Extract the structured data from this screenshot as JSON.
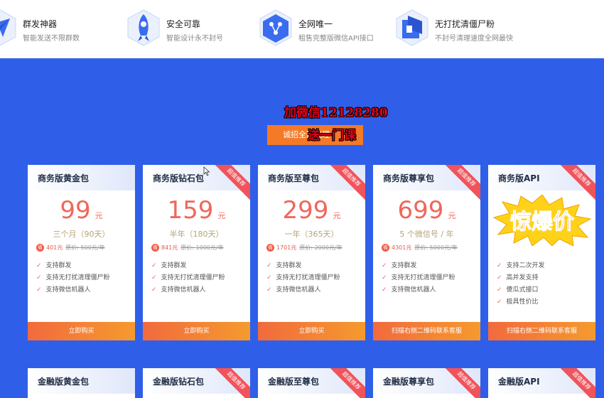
{
  "features": [
    {
      "title": "群发神器",
      "desc": "智能发送不限群数",
      "icon": "paper-plane-icon"
    },
    {
      "title": "安全可靠",
      "desc": "智能设计永不封号",
      "icon": "rocket-icon"
    },
    {
      "title": "全网唯一",
      "desc": "租售完整版微信API接口",
      "icon": "network-icon"
    },
    {
      "title": "无打扰清僵尸粉",
      "desc": "不封号清理速度全网最快",
      "icon": "shield-sweep-icon"
    }
  ],
  "promo": {
    "line1": "加微信12128280",
    "line2": "送一门课",
    "join_label": "诚招全国代理"
  },
  "ribbon_text": "超值推荐",
  "cards_row1": [
    {
      "title": "商务版黄金包",
      "price": "99",
      "unit": "元",
      "period": "三个月（90天）",
      "badge": "省",
      "save": "401元",
      "orig": "原价: 500元/年",
      "features": [
        "支持群发",
        "支持无打扰清理僵尸粉",
        "支持微信机器人"
      ],
      "button": "立即购买",
      "ribbon": false
    },
    {
      "title": "商务版钻石包",
      "price": "159",
      "unit": "元",
      "period": "半年（180天）",
      "badge": "省",
      "save": "841元",
      "orig": "原价: 1000元/年",
      "features": [
        "支持群发",
        "支持无打扰清理僵尸粉",
        "支持微信机器人"
      ],
      "button": "立即购买",
      "ribbon": true
    },
    {
      "title": "商务版至尊包",
      "price": "299",
      "unit": "元",
      "period": "一年（365天）",
      "badge": "省",
      "save": "1701元",
      "orig": "原价: 2000元/年",
      "features": [
        "支持群发",
        "支持无打扰清理僵尸粉",
        "支持微信机器人"
      ],
      "button": "立即购买",
      "ribbon": true
    },
    {
      "title": "商务版尊享包",
      "price": "699",
      "unit": "元",
      "period": "5 个微信号 / 年",
      "badge": "省",
      "save": "4301元",
      "orig": "原价: 5000元/年",
      "features": [
        "支持群发",
        "支持无打扰清理僵尸粉",
        "支持微信机器人"
      ],
      "button": "扫描右侧二维码联系客服",
      "ribbon": true
    },
    {
      "title": "商务版API",
      "burst": "惊爆价",
      "features": [
        "支持二次开发",
        "高并发支持",
        "傻瓜式接口",
        "极具性价比"
      ],
      "button": "扫描右侧二维码联系客服",
      "ribbon": true
    }
  ],
  "cards_row2": [
    {
      "title": "金融版黄金包",
      "ribbon": false
    },
    {
      "title": "金融版钻石包",
      "ribbon": true
    },
    {
      "title": "金融版至尊包",
      "ribbon": true
    },
    {
      "title": "金融版尊享包",
      "ribbon": true
    },
    {
      "title": "金融版API",
      "ribbon": true
    }
  ],
  "colors": {
    "background": "#2f5fe8",
    "price": "#f0665b",
    "button_start": "#f26a3d",
    "button_end": "#f59a2e",
    "ribbon": "#f0535a"
  }
}
